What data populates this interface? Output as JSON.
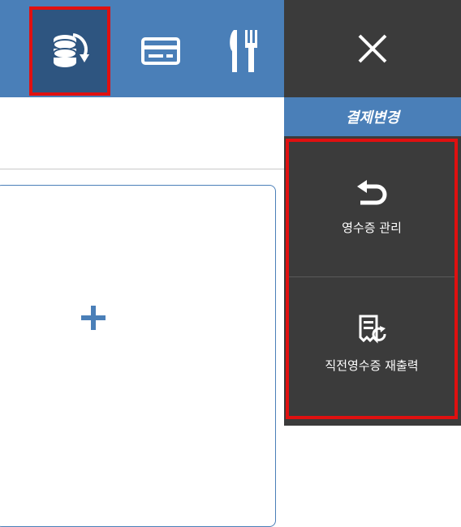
{
  "toolbar": {
    "icons": [
      {
        "name": "cash-exchange-icon",
        "selected": true
      },
      {
        "name": "card-icon",
        "selected": false
      },
      {
        "name": "dining-icon",
        "selected": false
      }
    ],
    "close_icon": "close-icon"
  },
  "mode_title": "결제변경",
  "actions": [
    {
      "label": "영수증 관리",
      "icon": "undo-arrow-icon"
    },
    {
      "label": "직전영수증 재출력",
      "icon": "receipt-reprint-icon"
    }
  ],
  "content": {
    "add_icon": "plus-icon"
  },
  "colors": {
    "accent_blue": "#4a7fb8",
    "dark_panel": "#3b3b3b",
    "selected_bg": "#2e5580",
    "highlight_red": "#e01010"
  }
}
